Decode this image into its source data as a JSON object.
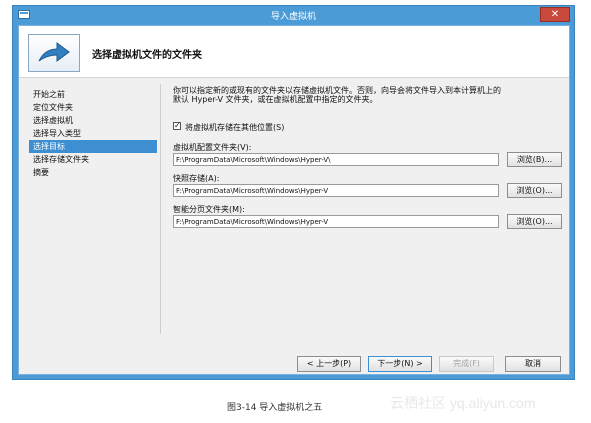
{
  "window": {
    "title": "导入虚拟机",
    "close_label": "✕"
  },
  "header": {
    "title": "选择虚拟机文件的文件夹",
    "icon": "arrow-icon"
  },
  "nav": {
    "items": [
      {
        "label": "开始之前",
        "active": false
      },
      {
        "label": "定位文件夹",
        "active": false
      },
      {
        "label": "选择虚拟机",
        "active": false
      },
      {
        "label": "选择导入类型",
        "active": false
      },
      {
        "label": "选择目标",
        "active": true
      },
      {
        "label": "选择存储文件夹",
        "active": false
      },
      {
        "label": "摘要",
        "active": false
      }
    ]
  },
  "content": {
    "intro_line1": "你可以指定新的或现有的文件夹以存储虚拟机文件。否则，向导会将文件导入到本计算机上的",
    "intro_line2": "默认 Hyper-V 文件夹，或在虚拟机配置中指定的文件夹。",
    "checkbox": {
      "checked": true,
      "mark": "✓",
      "label": "将虚拟机存储在其他位置(S)"
    },
    "fields": [
      {
        "label": "虚拟机配置文件夹(V):",
        "value": "F:\\ProgramData\\Microsoft\\Windows\\Hyper-V\\",
        "browse": "浏览(B)..."
      },
      {
        "label": "快照存储(A):",
        "value": "F:\\ProgramData\\Microsoft\\Windows\\Hyper-V",
        "browse": "浏览(O)..."
      },
      {
        "label": "智能分页文件夹(M):",
        "value": "F:\\ProgramData\\Microsoft\\Windows\\Hyper-V",
        "browse": "浏览(O)..."
      }
    ]
  },
  "footer": {
    "prev": "< 上一步(P)",
    "next": "下一步(N) >",
    "finish": "完成(F)",
    "cancel": "取消"
  },
  "caption": "图3-14   导入虚拟机之五",
  "watermark": "云栖社区 yq.aliyun.com",
  "colors": {
    "title_bar": "#4a9bd6",
    "close_button": "#c94a3d",
    "nav_active": "#3d8fd1"
  }
}
